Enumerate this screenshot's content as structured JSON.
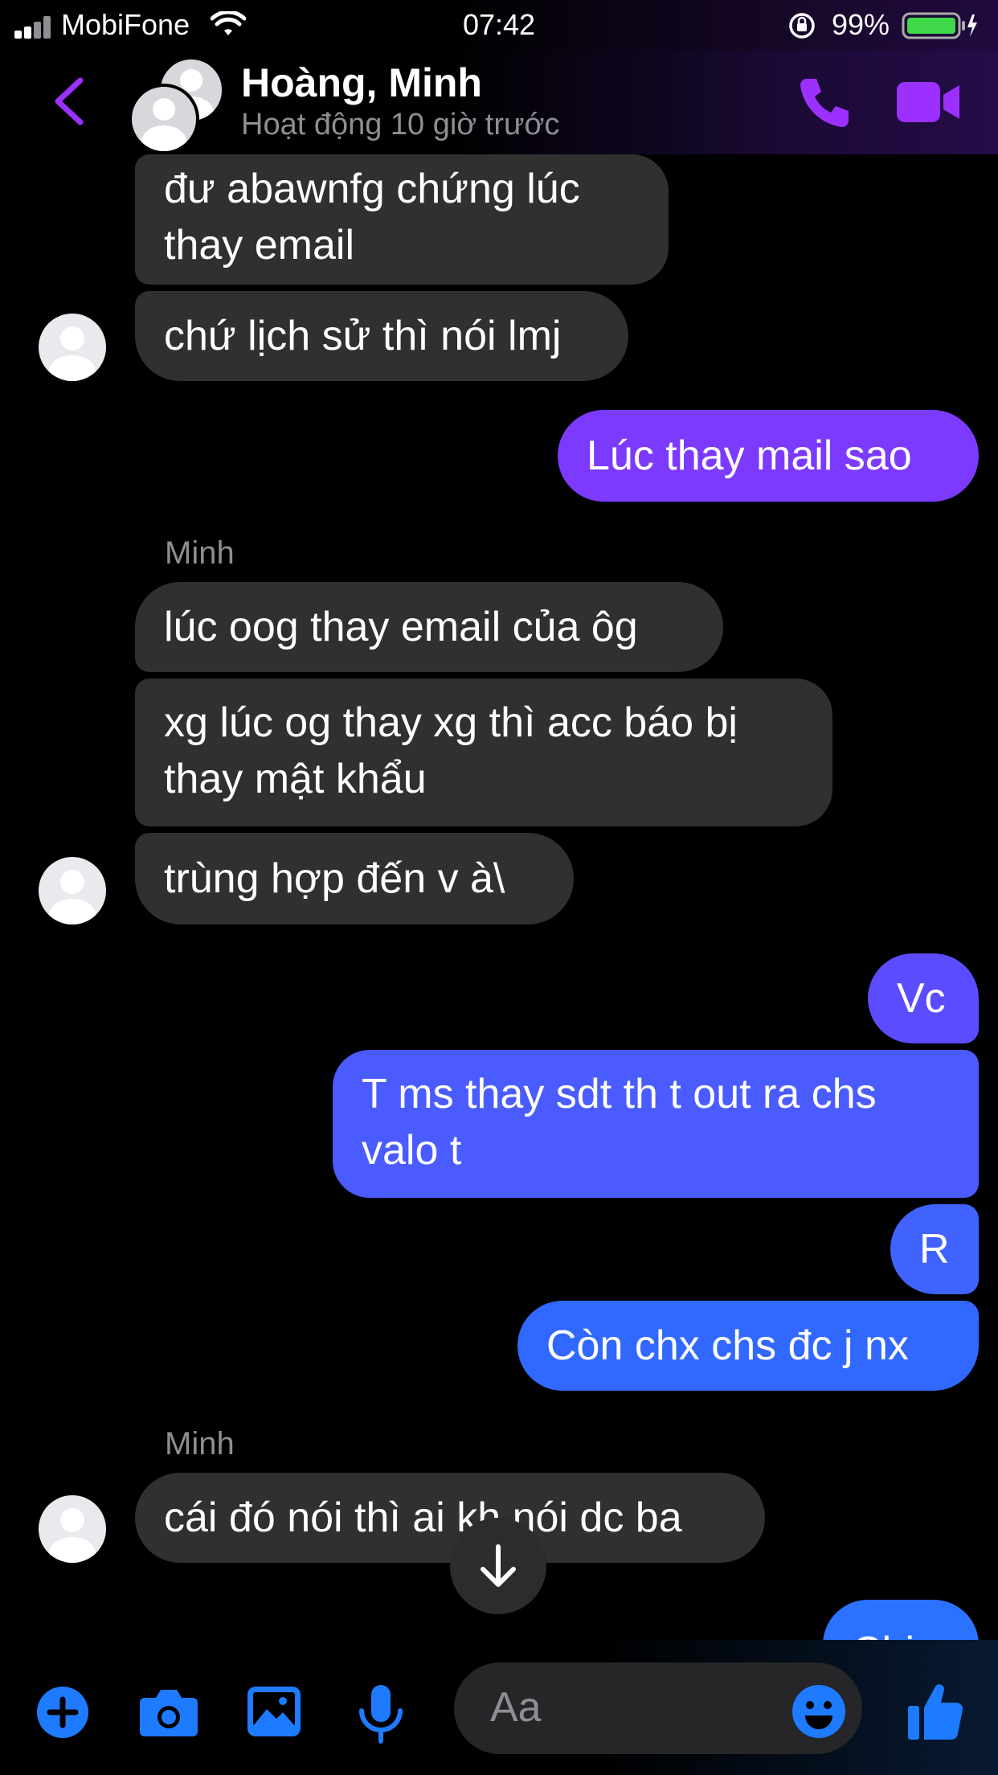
{
  "status_bar": {
    "carrier": "MobiFone",
    "time": "07:42",
    "battery": "99%"
  },
  "header": {
    "contact_name": "Hoàng, Minh",
    "activity": "Hoạt động 10 giờ trước"
  },
  "colors": {
    "accent_purple": "#9b30ff",
    "outgoing_purple": "#7c3aff",
    "outgoing_blue": "#4062ff",
    "incoming_gray": "#303030",
    "icon_blue": "#1e7bff"
  },
  "messages": [
    {
      "from": "Minh",
      "text_lines": [
        "đư abawnfg chứng lúc",
        "thay email"
      ]
    },
    {
      "from": "Minh",
      "text": "chứ lịch sử thì nói lmj"
    },
    {
      "from": "me",
      "text": "Lúc thay mail sao"
    },
    {
      "sender_label": "Minh"
    },
    {
      "from": "Minh",
      "text": "lúc oog thay email của ôg"
    },
    {
      "from": "Minh",
      "text_lines": [
        "xg lúc og thay xg thì acc báo bị",
        "thay mật khẩu"
      ]
    },
    {
      "from": "Minh",
      "text": "trùng hợp đến v à\\"
    },
    {
      "from": "me",
      "text": "Vc"
    },
    {
      "from": "me",
      "text_lines": [
        "T ms thay sdt th t out ra chs",
        "valo t"
      ]
    },
    {
      "from": "me",
      "text": "R"
    },
    {
      "from": "me",
      "text": "Còn chx chs đc j nx"
    },
    {
      "sender_label": "Minh"
    },
    {
      "from": "Minh",
      "text": "cái đó nói thì ai kh nói dc ba"
    },
    {
      "from": "me",
      "text": "Chịu"
    }
  ],
  "composer": {
    "placeholder": "Aa"
  },
  "icons": [
    "back-icon",
    "phone-icon",
    "video-icon",
    "plus-icon",
    "camera-icon",
    "gallery-icon",
    "mic-icon",
    "emoji-icon",
    "like-icon",
    "arrow-down-icon",
    "wifi-icon",
    "signal-icon",
    "lock-rotation-icon",
    "battery-icon"
  ]
}
